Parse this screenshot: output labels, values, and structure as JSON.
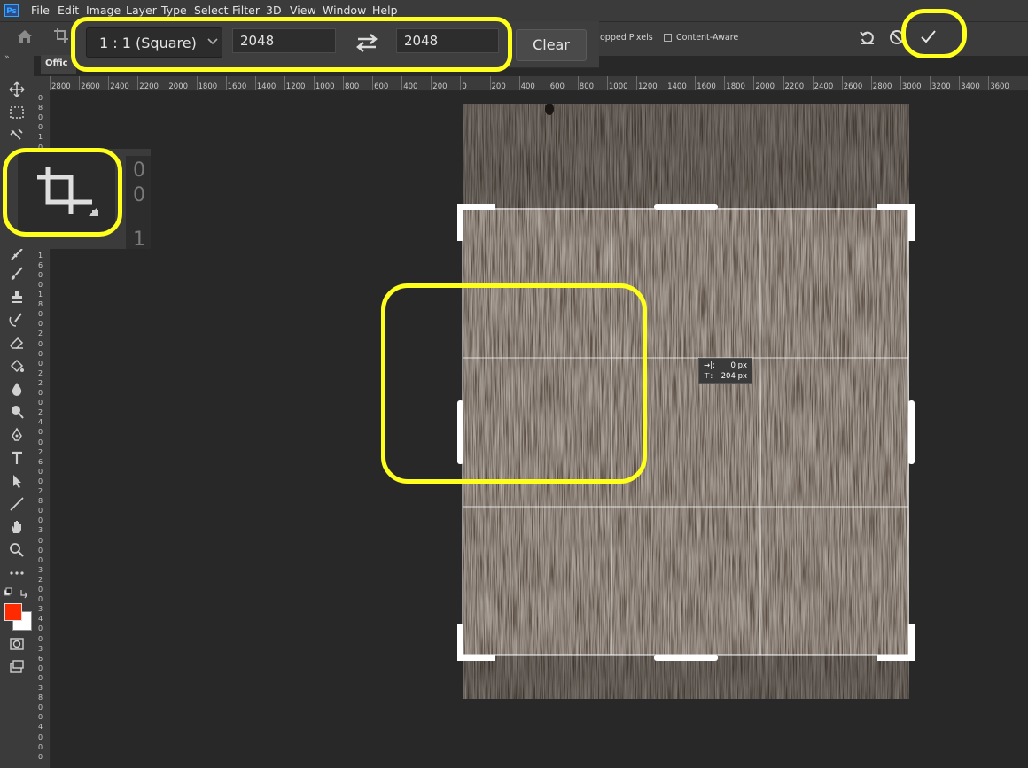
{
  "menu": [
    "File",
    "Edit",
    "Image",
    "Layer",
    "Type",
    "Select",
    "Filter",
    "3D",
    "View",
    "Window",
    "Help"
  ],
  "app_logo": "Ps",
  "options": {
    "ratio": "1 : 1 (Square)",
    "width": "2048",
    "height": "2048",
    "clear": "Clear",
    "delete_cropped": "opped Pixels",
    "content_aware": "Content-Aware",
    "content_aware_checked": false
  },
  "tab_label": "Offic",
  "ruler_h": [
    "2800",
    "2600",
    "2400",
    "2200",
    "2000",
    "1800",
    "1600",
    "1400",
    "1200",
    "1000",
    "800",
    "600",
    "400",
    "200",
    "0",
    "200",
    "400",
    "600",
    "800",
    "1000",
    "1200",
    "1400",
    "1600",
    "1800",
    "2000",
    "2200",
    "2400",
    "2600",
    "2800",
    "3000",
    "3200",
    "3400",
    "3600"
  ],
  "ruler_v": [
    "0",
    "8",
    "0",
    "0",
    "1",
    "0",
    "0",
    "0",
    "1",
    "2",
    "0",
    "0",
    "1",
    "4",
    "0",
    "0",
    "1",
    "6",
    "0",
    "0",
    "1",
    "8",
    "0",
    "0",
    "2",
    "0",
    "0",
    "0",
    "2",
    "2",
    "0",
    "0",
    "2",
    "4",
    "0",
    "0",
    "2",
    "6",
    "0",
    "0",
    "2",
    "8",
    "0",
    "0",
    "3",
    "0",
    "0",
    "0",
    "3",
    "2",
    "0",
    "0",
    "3",
    "4",
    "0",
    "0",
    "3",
    "6",
    "0",
    "0",
    "3",
    "8",
    "0",
    "0",
    "4",
    "0",
    "0",
    "0"
  ],
  "readout": {
    "dx_label": "→|:",
    "dx": "0 px",
    "dy_label": "⊤:",
    "dy": "204 px"
  },
  "zoom_inset_digits": [
    "0",
    "0",
    "1"
  ],
  "colors": {
    "highlight": "#ffff1e",
    "foreground": "#ff2a00",
    "background": "#ffffff",
    "ui": "#3b3b3b",
    "canvas": "#282828"
  },
  "icons": {
    "home": "home-icon",
    "crop": "crop-icon",
    "swap": "swap-icon",
    "reset": "reset-icon",
    "cancel": "cancel-icon",
    "commit": "commit-checkmark-icon",
    "chevron": "chevron-down-icon"
  }
}
